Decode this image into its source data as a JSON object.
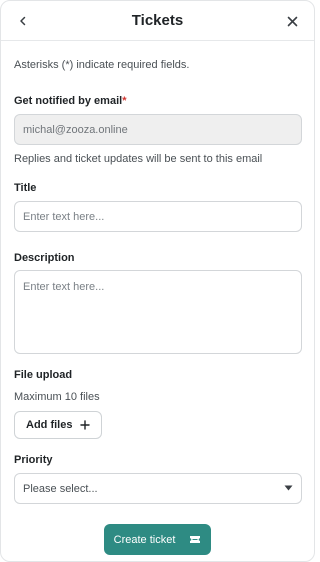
{
  "header": {
    "title": "Tickets",
    "back_icon": "chevron-left-icon",
    "close_icon": "close-icon"
  },
  "form": {
    "hint": "Asterisks (*) indicate required fields.",
    "email": {
      "label": "Get notified by email",
      "required_mark": "*",
      "value": "michal@zooza.online",
      "note": "Replies and ticket updates will be sent to this email"
    },
    "title": {
      "label": "Title",
      "placeholder": "Enter text here..."
    },
    "description": {
      "label": "Description",
      "placeholder": "Enter text here..."
    },
    "upload": {
      "label": "File upload",
      "note": "Maximum 10 files",
      "button_label": "Add files",
      "button_icon": "plus-icon"
    },
    "priority": {
      "label": "Priority",
      "selected": "Please select...",
      "icon": "caret-down-icon"
    },
    "submit": {
      "label": "Create ticket",
      "icon": "ticket-icon"
    }
  },
  "colors": {
    "accent": "#2e8b83",
    "required": "#d1342f",
    "readonly_bg": "#efefef"
  }
}
